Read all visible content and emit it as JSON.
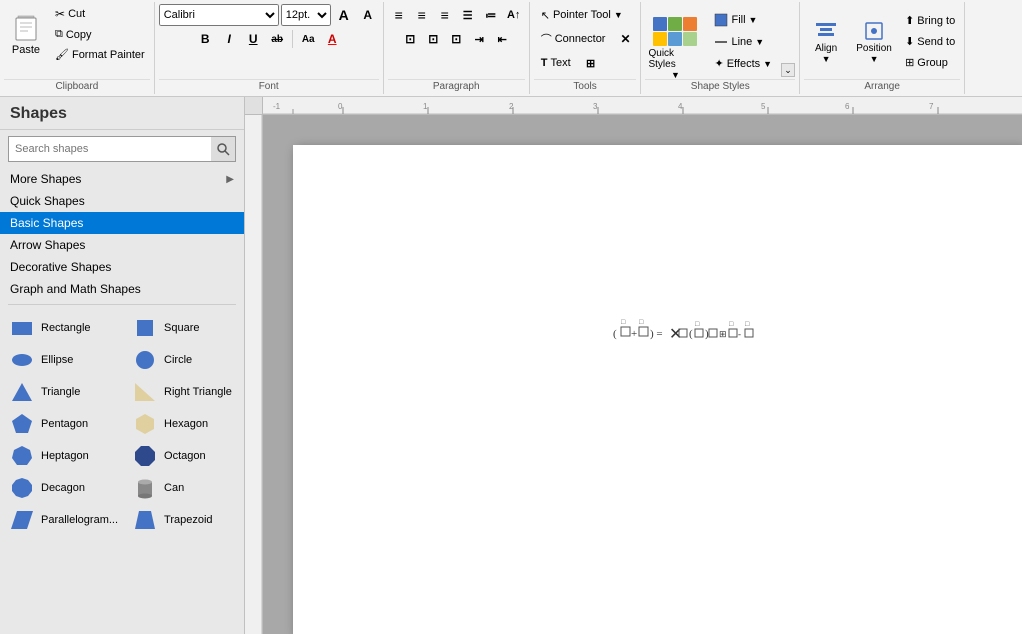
{
  "ribbon": {
    "groups": {
      "clipboard": {
        "label": "Clipboard",
        "paste": "Paste",
        "cut": "Cut",
        "copy": "Copy",
        "format_painter": "Format Painter"
      },
      "font": {
        "label": "Font",
        "font_name": "Calibri",
        "font_size": "12pt.",
        "grow": "A",
        "shrink": "A",
        "bold": "B",
        "italic": "I",
        "underline": "U",
        "strikethrough": "ab",
        "font_color": "A"
      },
      "paragraph": {
        "label": "Paragraph",
        "expand": "⌄"
      },
      "tools": {
        "label": "Tools",
        "pointer": "Pointer Tool",
        "connector": "Connector",
        "text": "Text"
      },
      "shape_styles": {
        "label": "Shape Styles",
        "quick_styles": "Quick Styles",
        "fill": "Fill",
        "line": "Line",
        "effects": "Effects",
        "expand": "⌄"
      },
      "arrange": {
        "label": "Arrange",
        "align": "Align",
        "position": "Position",
        "bring_to": "Bring to",
        "send_to": "Send to",
        "group": "Group"
      }
    }
  },
  "sidebar": {
    "title": "Shapes",
    "search_placeholder": "Search shapes",
    "items": [
      {
        "label": "More Shapes",
        "has_arrow": true
      },
      {
        "label": "Quick Shapes",
        "has_arrow": false
      },
      {
        "label": "Basic Shapes",
        "has_arrow": false,
        "active": true
      },
      {
        "label": "Arrow Shapes",
        "has_arrow": false
      },
      {
        "label": "Decorative Shapes",
        "has_arrow": false
      },
      {
        "label": "Graph and Math Shapes",
        "has_arrow": false
      }
    ],
    "shapes": [
      {
        "name": "Rectangle",
        "shape": "rect"
      },
      {
        "name": "Square",
        "shape": "square"
      },
      {
        "name": "Ellipse",
        "shape": "ellipse"
      },
      {
        "name": "Circle",
        "shape": "circle"
      },
      {
        "name": "Triangle",
        "shape": "triangle"
      },
      {
        "name": "Right Triangle",
        "shape": "right-triangle"
      },
      {
        "name": "Pentagon",
        "shape": "pentagon"
      },
      {
        "name": "Hexagon",
        "shape": "hexagon"
      },
      {
        "name": "Heptagon",
        "shape": "heptagon"
      },
      {
        "name": "Octagon",
        "shape": "octagon"
      },
      {
        "name": "Decagon",
        "shape": "decagon"
      },
      {
        "name": "Can",
        "shape": "can"
      },
      {
        "name": "Parallelogram...",
        "shape": "parallelogram"
      },
      {
        "name": "Trapezoid",
        "shape": "trapezoid"
      }
    ]
  },
  "canvas": {
    "page_content": "(⊞+ ⊞) = ×□(⊞)⊞ ⊞⊞-⊞"
  },
  "colors": {
    "active_blue": "#0078d7",
    "ribbon_bg": "#f3f3f3",
    "shape_blue": "#4472c4",
    "shape_dark_blue": "#2e4a8c"
  }
}
